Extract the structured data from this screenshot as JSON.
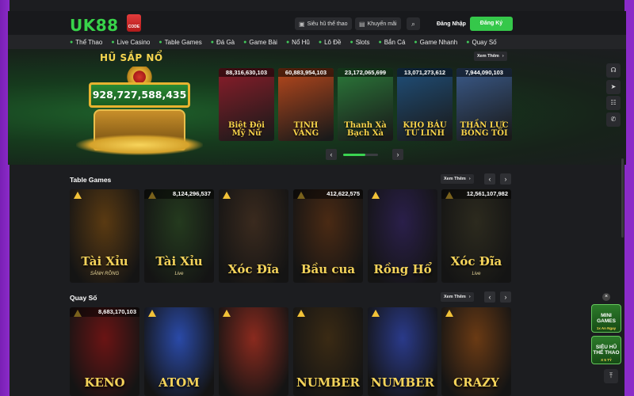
{
  "header": {
    "logo_text": "UK88",
    "logo_badge": "CODE",
    "jackpot_link": "Siêu hũ thể thao",
    "promo_link": "Khuyến mãi",
    "login_label": "Đăng Nhập",
    "signup_label": "Đăng Ký"
  },
  "nav": [
    {
      "label": "Thể Thao",
      "icon": "ball-icon"
    },
    {
      "label": "Live Casino",
      "icon": "casino-icon"
    },
    {
      "label": "Table Games",
      "icon": "cards-icon"
    },
    {
      "label": "Đá Gà",
      "icon": "rooster-icon"
    },
    {
      "label": "Game Bài",
      "icon": "card-icon"
    },
    {
      "label": "Nổ Hũ",
      "icon": "jar-icon"
    },
    {
      "label": "Lô Đề",
      "icon": "lottery-icon"
    },
    {
      "label": "Slots",
      "icon": "slot-icon"
    },
    {
      "label": "Bắn Cá",
      "icon": "fish-icon"
    },
    {
      "label": "Game Nhanh",
      "icon": "rocket-icon"
    },
    {
      "label": "Quay Số",
      "icon": "wheel-icon"
    }
  ],
  "jackpot": {
    "title": "HŨ SẮP NỔ",
    "total": "928,727,588,435",
    "see_more": "Xem Thêm",
    "cards": [
      {
        "amount": "88,316,630,103",
        "title": "Biệt Đội Mỹ Nữ",
        "color": "#8c1d2a"
      },
      {
        "amount": "60,883,954,103",
        "title": "TINH VÀNG",
        "color": "#b8481c"
      },
      {
        "amount": "23,172,065,699",
        "title": "Thanh Xà Bạch Xà",
        "color": "#2b7a3a"
      },
      {
        "amount": "13,071,273,612",
        "title": "KHO BÁU TỨ LINH",
        "color": "#1f4f7a"
      },
      {
        "amount": "7,944,090,103",
        "title": "THẦN LỰC BÓNG TỐI",
        "color": "#3a5a8a"
      }
    ]
  },
  "table_games": {
    "title": "Table Games",
    "see_more": "Xem Thêm",
    "cards": [
      {
        "jackpot": "",
        "title": "Tài Xỉu",
        "subtitle": "SẢNH RỒNG",
        "color": "#5a3a12"
      },
      {
        "jackpot": "8,124,296,537",
        "title": "Tài Xỉu",
        "subtitle": "Live",
        "color": "#243a1e"
      },
      {
        "jackpot": "",
        "title": "Xóc Đĩa",
        "subtitle": "",
        "color": "#3a2a1e"
      },
      {
        "jackpot": "412,622,575",
        "title": "Bầu cua",
        "subtitle": "",
        "color": "#4a2a14"
      },
      {
        "jackpot": "",
        "title": "Rồng Hổ",
        "subtitle": "",
        "color": "#2a1f4a"
      },
      {
        "jackpot": "12,561,107,982",
        "title": "Xóc Đĩa",
        "subtitle": "Live",
        "color": "#2c2a1e"
      }
    ]
  },
  "quay_so": {
    "title": "Quay Số",
    "see_more": "Xem Thêm",
    "cards": [
      {
        "jackpot": "8,683,170,103",
        "title": "KENO",
        "color": "#6a1414"
      },
      {
        "jackpot": "",
        "title": "ATOM",
        "color": "#2a4aa8"
      },
      {
        "jackpot": "",
        "title": "",
        "color": "#8a2a1e"
      },
      {
        "jackpot": "",
        "title": "NUMBER",
        "color": "#3a2a14"
      },
      {
        "jackpot": "",
        "title": "NUMBER",
        "color": "#2a3a8a"
      },
      {
        "jackpot": "",
        "title": "CRAZY",
        "color": "#6a3a14"
      }
    ]
  },
  "float": {
    "mini_games": "MINI GAMES",
    "mini_sub": "1x An Ngay",
    "sports_jackpot": "SIÊU HŨ THỂ THAO",
    "sports_sub": "X 5 TỶ"
  }
}
